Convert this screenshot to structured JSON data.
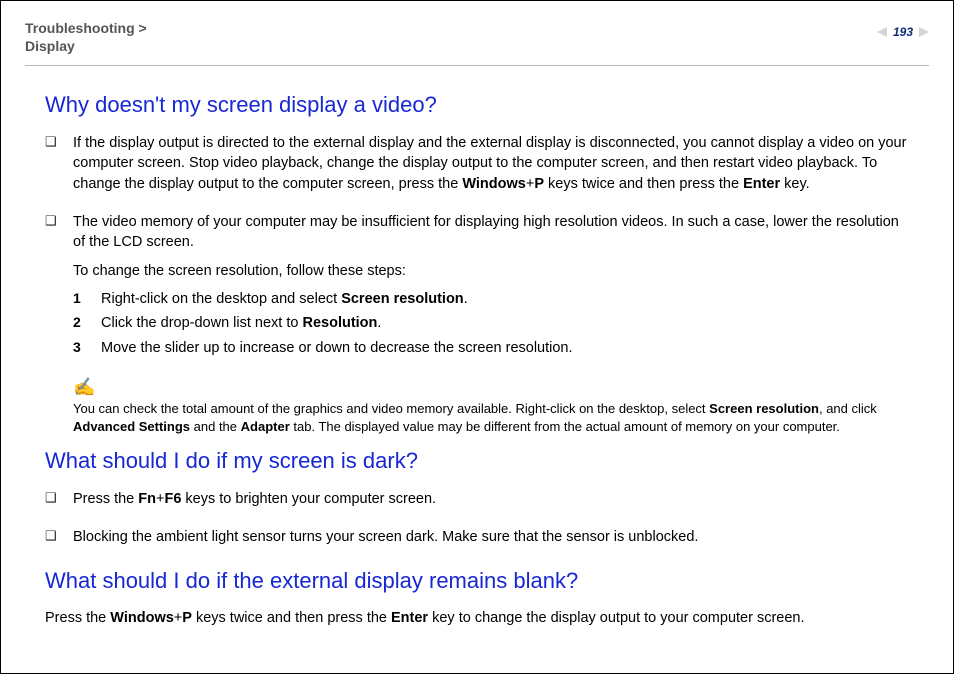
{
  "breadcrumb": {
    "section": "Troubleshooting",
    "sep": " > ",
    "page": "Display"
  },
  "pageNumber": "193",
  "q1": {
    "heading": "Why doesn't my screen display a video?",
    "b1_pre": "If the display output is directed to the external display and the external display is disconnected, you cannot display a video on your computer screen. Stop video playback, change the display output to the computer screen, and then restart video playback. To change the display output to the computer screen, press the ",
    "b1_k1": "Windows",
    "b1_plus": "+",
    "b1_k2": "P",
    "b1_mid": " keys twice and then press the ",
    "b1_k3": "Enter",
    "b1_post": " key.",
    "b2_p1": "The video memory of your computer may be insufficient for displaying high resolution videos. In such a case, lower the resolution of the LCD screen.",
    "b2_p2": "To change the screen resolution, follow these steps:",
    "s1_pre": "Right-click on the desktop and select ",
    "s1_bold": "Screen resolution",
    "s1_post": ".",
    "s2_pre": "Click the drop-down list next to ",
    "s2_bold": "Resolution",
    "s2_post": ".",
    "s3": "Move the slider up to increase or down to decrease the screen resolution.",
    "nums": {
      "n1": "1",
      "n2": "2",
      "n3": "3"
    },
    "note_icon": "✍",
    "note_pre": "You can check the total amount of the graphics and video memory available. Right-click on the desktop, select ",
    "note_b1": "Screen resolution",
    "note_mid1": ", and click ",
    "note_b2": "Advanced Settings",
    "note_mid2": " and the ",
    "note_b3": "Adapter",
    "note_post": " tab. The displayed value may be different from the actual amount of memory on your computer."
  },
  "q2": {
    "heading": "What should I do if my screen is dark?",
    "b1_pre": "Press the ",
    "b1_k1": "Fn",
    "b1_plus": "+",
    "b1_k2": "F6",
    "b1_post": " keys to brighten your computer screen.",
    "b2": "Blocking the ambient light sensor turns your screen dark. Make sure that the sensor is unblocked."
  },
  "q3": {
    "heading": "What should I do if the external display remains blank?",
    "p_pre": "Press the ",
    "p_k1": "Windows",
    "p_plus": "+",
    "p_k2": "P",
    "p_mid": " keys twice and then press the ",
    "p_k3": "Enter",
    "p_post": " key to change the display output to your computer screen."
  }
}
